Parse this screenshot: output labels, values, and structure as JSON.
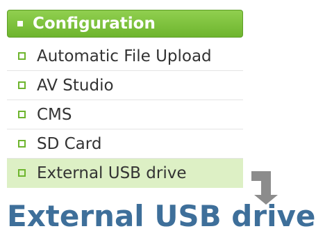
{
  "menu": {
    "header_label": "Configuration",
    "items": [
      {
        "label": "Automatic File Upload",
        "active": false
      },
      {
        "label": "AV Studio",
        "active": false
      },
      {
        "label": "CMS",
        "active": false
      },
      {
        "label": "SD Card",
        "active": false
      },
      {
        "label": "External USB drive",
        "active": true
      }
    ]
  },
  "page_title": "External USB drive",
  "colors": {
    "accent_green": "#6eb52e",
    "active_bg": "#ddf0c5",
    "title_blue": "#3e6f9a",
    "arrow_gray": "#8c8c8c"
  },
  "icons": {
    "arrow": "down-right-arrow-icon"
  }
}
